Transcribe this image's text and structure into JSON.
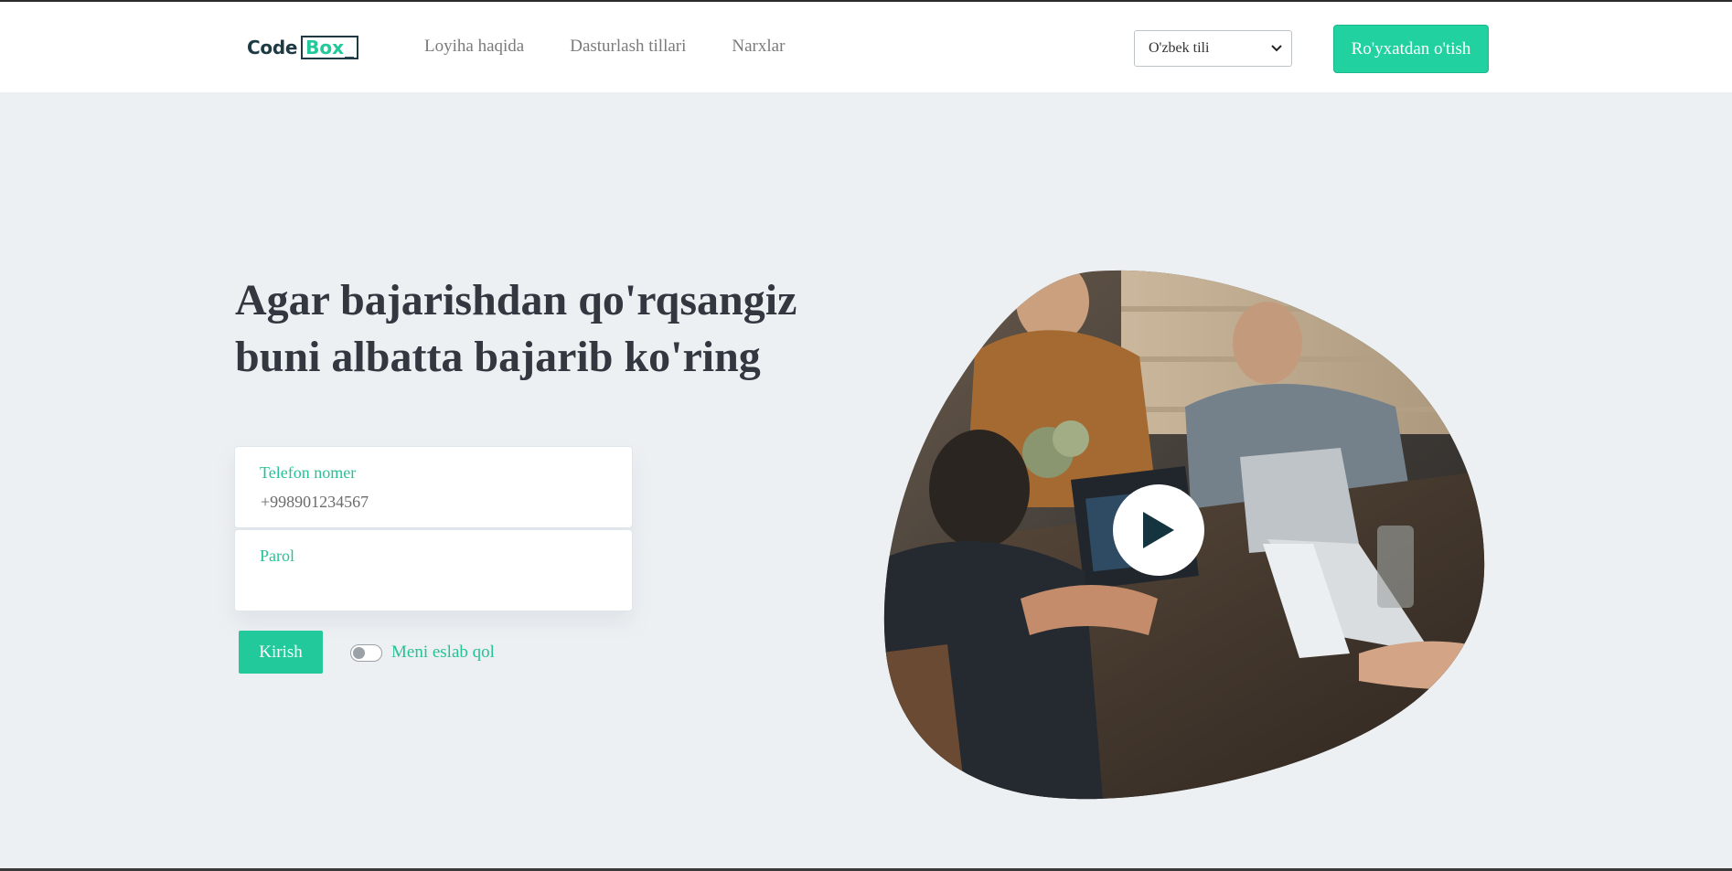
{
  "header": {
    "logo": {
      "code": "Code",
      "box": "Box",
      "cursor": "_"
    },
    "nav": [
      {
        "label": "Loyiha haqida"
      },
      {
        "label": "Dasturlash tillari"
      },
      {
        "label": "Narxlar"
      }
    ],
    "language": {
      "selected": "O'zbek tili"
    },
    "register_label": "Ro'yxatdan o'tish"
  },
  "hero": {
    "title_line1": "Agar bajarishdan qo'rqsangiz",
    "title_line2": "buni albatta bajarib ko'ring"
  },
  "form": {
    "phone_label": "Telefon nomer",
    "phone_value": "+998901234567",
    "password_label": "Parol",
    "password_value": "",
    "login_label": "Kirish",
    "remember_label": "Meni eslab qol",
    "remember_checked": false
  },
  "colors": {
    "accent": "#22c99a",
    "page_bg": "#edf0f3",
    "heading": "#333740"
  },
  "icons": {
    "play": "play-icon",
    "select_chevron": "chevron-down-icon"
  }
}
